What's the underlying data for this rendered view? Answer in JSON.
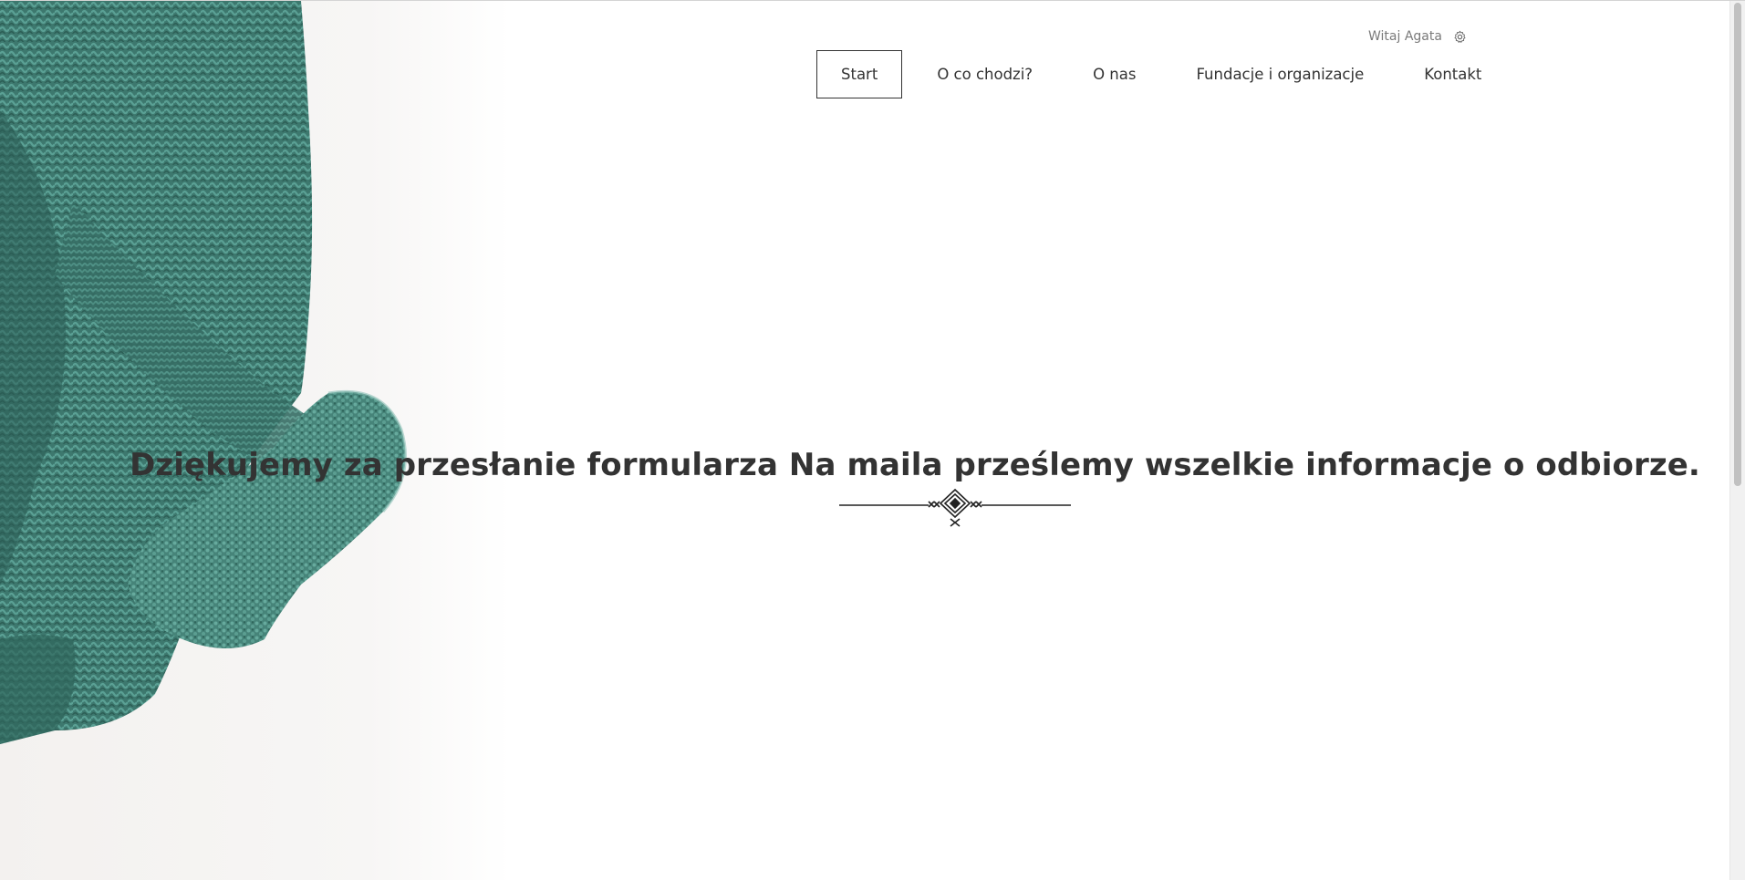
{
  "user": {
    "greeting": "Witaj Agata",
    "settings_icon": "gear-icon"
  },
  "nav": {
    "items": [
      {
        "label": "Start",
        "active": true
      },
      {
        "label": "O co chodzi?",
        "active": false
      },
      {
        "label": "O nas",
        "active": false
      },
      {
        "label": "Fundacje i organizacje",
        "active": false
      },
      {
        "label": "Kontakt",
        "active": false
      }
    ]
  },
  "main": {
    "message": "Dziękujemy za przesłanie formularza Na maila prześlemy wszelkie informacje o odbiorze."
  },
  "colors": {
    "text": "#333333",
    "muted": "#7a7a7a",
    "sweater": "#3f7d73"
  }
}
